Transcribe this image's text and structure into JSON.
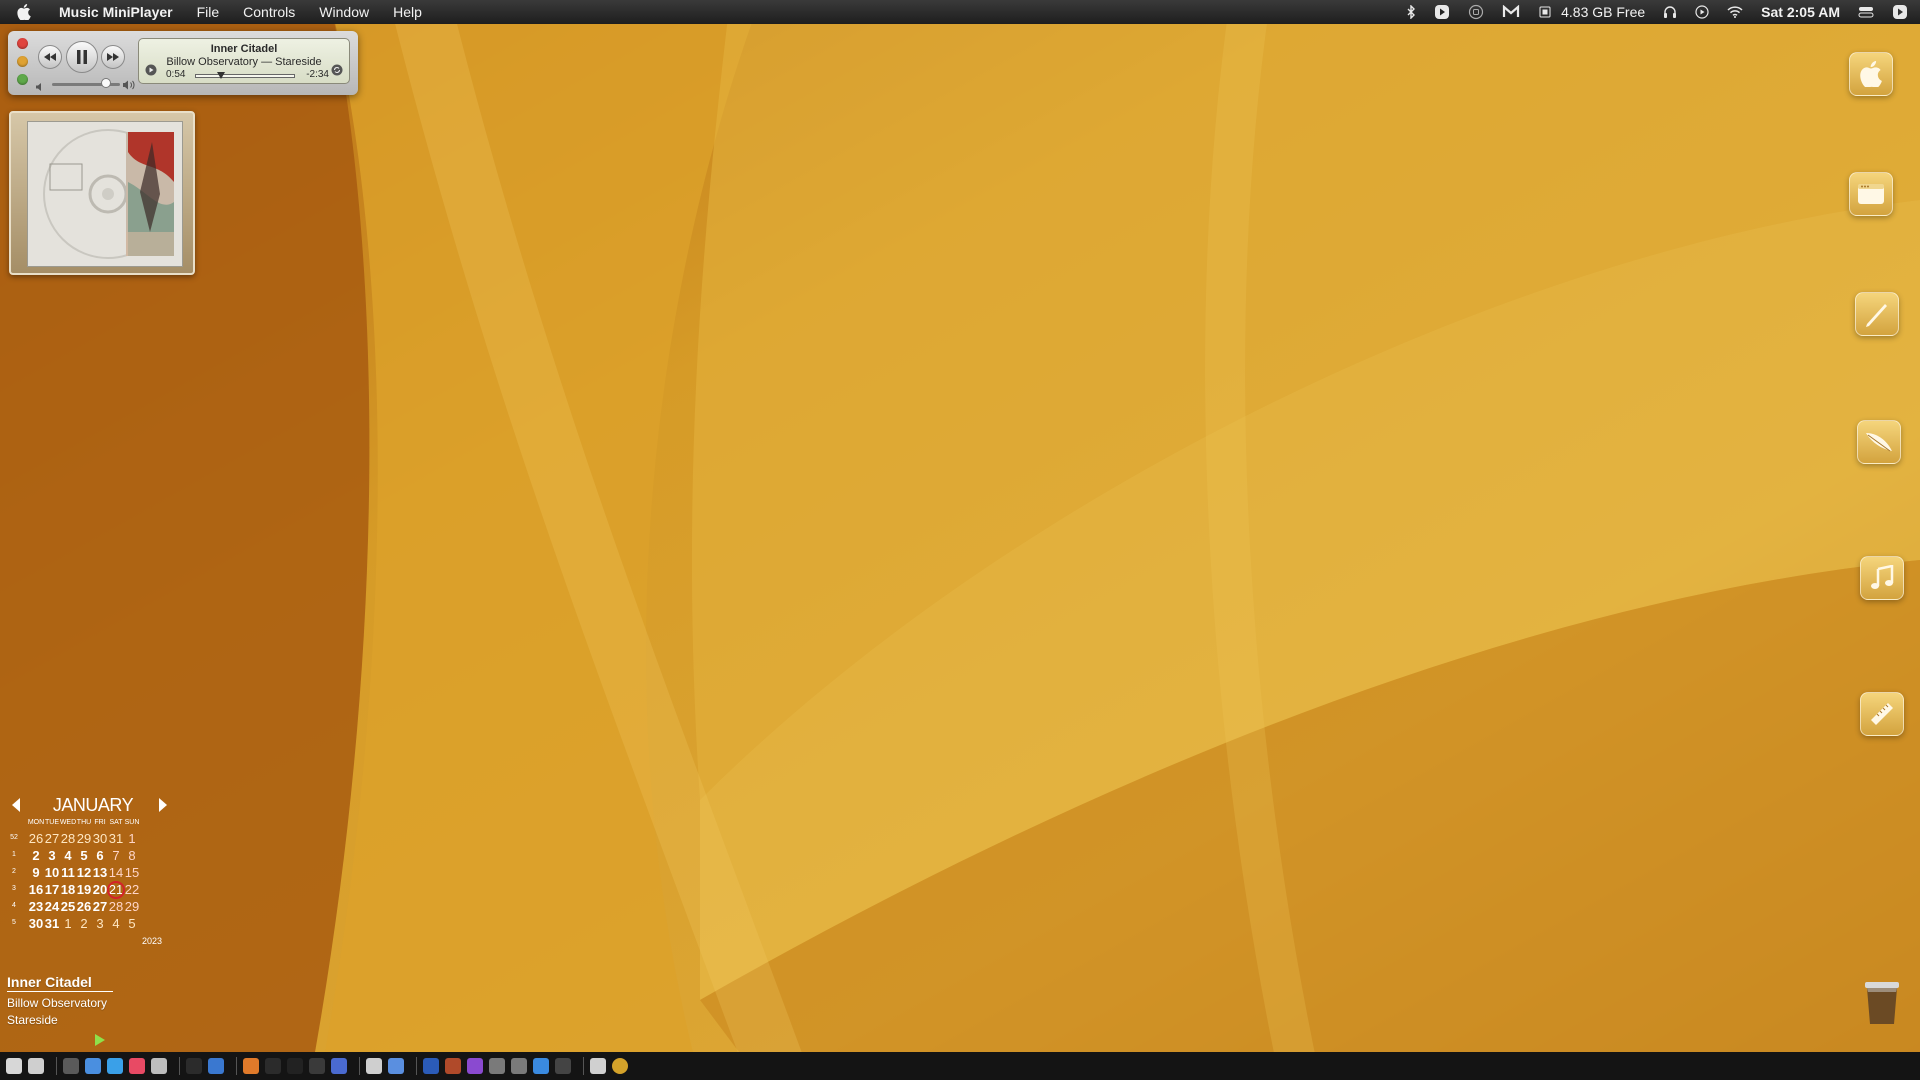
{
  "menubar": {
    "app_name": "Music MiniPlayer",
    "menus": [
      "File",
      "Controls",
      "Window",
      "Help"
    ],
    "status": {
      "disk_free": "4.83 GB Free",
      "clock": "Sat 2:05 AM"
    },
    "icons": [
      "apple-logo-icon",
      "bluetooth-icon",
      "play-circle-icon",
      "dot-circle-icon",
      "mail-m-icon",
      "memory-chip-icon",
      "headphones-icon",
      "play-circle-small-icon",
      "wifi-icon",
      "control-center-icon",
      "siri-icon"
    ]
  },
  "miniplayer": {
    "track_title": "Inner Citadel",
    "subtitle": "Billow Observatory — Stareside",
    "elapsed": "0:54",
    "remaining": "-2:34",
    "progress_fraction": 0.26,
    "volume_fraction": 0.8
  },
  "calendar": {
    "month": "JANUARY",
    "year": "2023",
    "weekdays": [
      "MON",
      "TUE",
      "WED",
      "THU",
      "FRI",
      "SAT",
      "SUN"
    ],
    "weeks": [
      {
        "num": "52",
        "days": [
          "26",
          "27",
          "28",
          "29",
          "30",
          "31",
          "1"
        ]
      },
      {
        "num": "1",
        "days": [
          "2",
          "3",
          "4",
          "5",
          "6",
          "7",
          "8"
        ]
      },
      {
        "num": "2",
        "days": [
          "9",
          "10",
          "11",
          "12",
          "13",
          "14",
          "15"
        ]
      },
      {
        "num": "3",
        "days": [
          "16",
          "17",
          "18",
          "19",
          "20",
          "21",
          "22"
        ]
      },
      {
        "num": "4",
        "days": [
          "23",
          "24",
          "25",
          "26",
          "27",
          "28",
          "29"
        ]
      },
      {
        "num": "5",
        "days": [
          "30",
          "31",
          "1",
          "2",
          "3",
          "4",
          "5"
        ]
      }
    ],
    "today": "21"
  },
  "now_playing": {
    "title": "Inner Citadel",
    "artist": "Billow Observatory",
    "album": "Stareside"
  },
  "drawer_icons": [
    "apple-icon",
    "window-icon",
    "pencil-icon",
    "feather-icon",
    "music-note-icon",
    "ruler-icon"
  ],
  "colors": {
    "wallpaper_base": "#c98a1c",
    "wallpaper_light": "#e8b743",
    "calendar_today_ring": "#d4222a",
    "play_green": "#8fe04a"
  }
}
